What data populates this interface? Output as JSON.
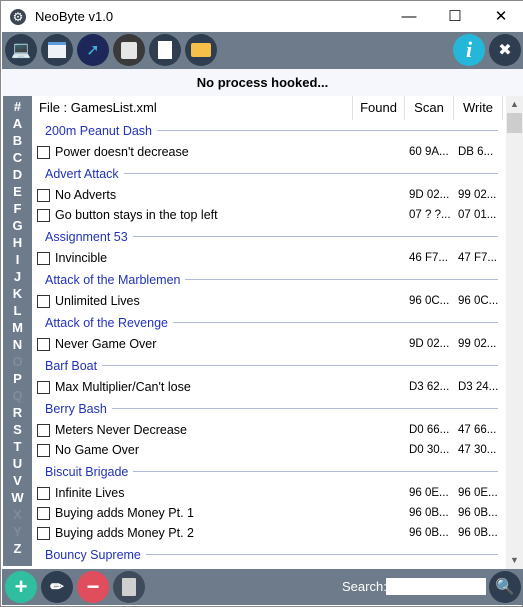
{
  "window": {
    "title": "NeoByte v1.0",
    "minimize": "—",
    "maximize": "☐",
    "close": "✕"
  },
  "toolbar": {
    "icons": [
      "laptop-icon",
      "window-icon",
      "pointer-icon",
      "floppy-icon",
      "document-icon",
      "folder-icon",
      "info-icon",
      "tools-icon"
    ]
  },
  "status": "No process hooked...",
  "alphabet": [
    {
      "l": "#",
      "on": true
    },
    {
      "l": "A",
      "on": true
    },
    {
      "l": "B",
      "on": true
    },
    {
      "l": "C",
      "on": true
    },
    {
      "l": "D",
      "on": true
    },
    {
      "l": "E",
      "on": true
    },
    {
      "l": "F",
      "on": true
    },
    {
      "l": "G",
      "on": true
    },
    {
      "l": "H",
      "on": true
    },
    {
      "l": "I",
      "on": true
    },
    {
      "l": "J",
      "on": true
    },
    {
      "l": "K",
      "on": true
    },
    {
      "l": "L",
      "on": true
    },
    {
      "l": "M",
      "on": true
    },
    {
      "l": "N",
      "on": true
    },
    {
      "l": "O",
      "on": false
    },
    {
      "l": "P",
      "on": true
    },
    {
      "l": "Q",
      "on": false
    },
    {
      "l": "R",
      "on": true
    },
    {
      "l": "S",
      "on": true
    },
    {
      "l": "T",
      "on": true
    },
    {
      "l": "U",
      "on": true
    },
    {
      "l": "V",
      "on": true
    },
    {
      "l": "W",
      "on": true
    },
    {
      "l": "X",
      "on": false
    },
    {
      "l": "Y",
      "on": false
    },
    {
      "l": "Z",
      "on": true
    }
  ],
  "header": {
    "file": "File : GamesList.xml",
    "found": "Found",
    "scan": "Scan",
    "write": "Write"
  },
  "games": [
    {
      "name": "200m Peanut Dash",
      "cheats": [
        {
          "label": "Power doesn't decrease",
          "scan": "60 9A...",
          "write": "DB 6...",
          "checked": false
        }
      ]
    },
    {
      "name": "Advert Attack",
      "cheats": [
        {
          "label": "No Adverts",
          "scan": "9D 02...",
          "write": "99 02...",
          "checked": false
        },
        {
          "label": "Go button stays in the top left",
          "scan": "07 ? ?...",
          "write": "07 01...",
          "checked": false
        }
      ]
    },
    {
      "name": "Assignment 53",
      "cheats": [
        {
          "label": "Invincible",
          "scan": "46 F7...",
          "write": "47 F7...",
          "checked": false
        }
      ]
    },
    {
      "name": "Attack of the Marblemen",
      "cheats": [
        {
          "label": "Unlimited Lives",
          "scan": "96 0C...",
          "write": "96 0C...",
          "checked": false
        }
      ]
    },
    {
      "name": "Attack of the Revenge",
      "cheats": [
        {
          "label": "Never Game Over",
          "scan": "9D 02...",
          "write": "99 02...",
          "checked": false
        }
      ]
    },
    {
      "name": "Barf Boat",
      "cheats": [
        {
          "label": "Max Multiplier/Can't lose",
          "scan": "D3 62...",
          "write": "D3 24...",
          "checked": false
        }
      ]
    },
    {
      "name": "Berry Bash",
      "cheats": [
        {
          "label": "Meters Never Decrease",
          "scan": "D0 66...",
          "write": "47 66...",
          "checked": false
        },
        {
          "label": "No Game Over",
          "scan": "D0 30...",
          "write": "47 30...",
          "checked": false
        }
      ]
    },
    {
      "name": "Biscuit Brigade",
      "cheats": [
        {
          "label": "Infinite Lives",
          "scan": "96 0E...",
          "write": "96 0E...",
          "checked": false
        },
        {
          "label": "Buying adds Money Pt. 1",
          "scan": "96 0B...",
          "write": "96 0B...",
          "checked": false
        },
        {
          "label": "Buying adds Money Pt. 2",
          "scan": "96 0B...",
          "write": "96 0B...",
          "checked": false
        }
      ]
    },
    {
      "name": "Bouncy Supreme",
      "cheats": []
    }
  ],
  "bottom": {
    "search_label": "Search:",
    "search_value": "",
    "icons": [
      "add-icon",
      "edit-icon",
      "remove-icon",
      "trash-icon",
      "search-icon"
    ]
  }
}
